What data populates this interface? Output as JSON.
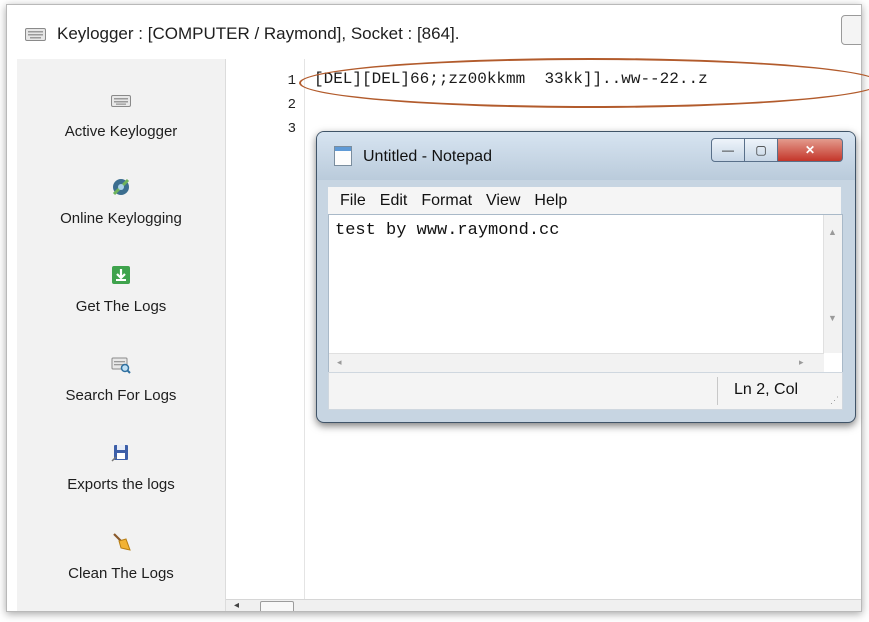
{
  "window": {
    "title": "Keylogger : [COMPUTER / Raymond], Socket : [864]."
  },
  "sidebar": {
    "items": [
      {
        "label": "Active Keylogger",
        "icon": "keyboard-icon"
      },
      {
        "label": "Online Keylogging",
        "icon": "satellite-icon"
      },
      {
        "label": "Get The Logs",
        "icon": "download-icon"
      },
      {
        "label": "Search For Logs",
        "icon": "search-logs-icon"
      },
      {
        "label": "Exports the logs",
        "icon": "floppy-export-icon"
      },
      {
        "label": "Clean The Logs",
        "icon": "broom-icon"
      }
    ]
  },
  "editor": {
    "line_numbers": [
      "1",
      "2",
      "3"
    ],
    "lines": [
      "[DEL][DEL]66;;zz00kkmm  33kk]]..ww--22..z",
      "",
      ""
    ]
  },
  "annotation": {
    "color": "#b25b2c"
  },
  "notepad": {
    "title": "Untitled - Notepad",
    "menu": [
      "File",
      "Edit",
      "Format",
      "View",
      "Help"
    ],
    "content": "test by www.raymond.cc",
    "status": "Ln 2, Col"
  },
  "colors": {
    "sidebar_bg": "#f2f2f2",
    "notepad_frame": "#c7d5e2",
    "close_button": "#c4362a"
  }
}
